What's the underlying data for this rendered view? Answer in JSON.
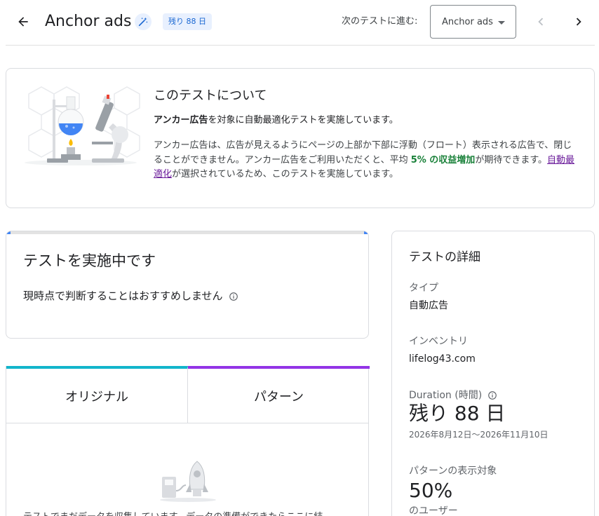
{
  "header": {
    "title": "Anchor ads",
    "days_chip": "残り 88 日",
    "next_label": "次のテストに進む:",
    "next_select_value": "Anchor ads"
  },
  "about": {
    "title": "このテストについて",
    "lead_bold": "アンカー広告",
    "lead_rest": "を対象に自動最適化テストを実施しています。",
    "body_part1": "アンカー広告は、広告が見えるようにページの上部か下部に浮動（フロート）表示される広告で、閉じることができません。アンカー広告をご利用いただくと、平均 ",
    "body_highlight": "5% の収益増加",
    "body_part2": "が期待できます。",
    "body_link": "自動最適化",
    "body_part3": "が選択されているため、このテストを実施しています。"
  },
  "status": {
    "title": "テストを実施中です",
    "note": "現時点で判断することはおすすめしません"
  },
  "compare": {
    "tab_original": "オリジナル",
    "tab_pattern": "パターン",
    "message": "テストでまだデータを収集しています。データの準備ができたらここに結"
  },
  "details": {
    "title": "テストの詳細",
    "type_label": "タイプ",
    "type_value": "自動広告",
    "inventory_label": "インベントリ",
    "inventory_value": "lifelog43.com",
    "duration_label": "Duration (時間)",
    "duration_value": "残り 88 日",
    "duration_range": "2026年8月12日～2026年11月10日",
    "target_label": "パターンの表示対象",
    "target_value": "50%",
    "target_unit": "のユーザー"
  },
  "colors": {
    "accent_blue": "#1967d2",
    "progress_blue": "#4285f4",
    "original_tab": "#12b5cb",
    "pattern_tab": "#9334e6",
    "highlight_green": "#188038",
    "link_purple": "#6a1b9a"
  },
  "icons": [
    "arrow-back-icon",
    "magic-wand-icon",
    "chevron-down-icon",
    "chevron-left-icon",
    "chevron-right-icon",
    "info-icon",
    "lab-illustration",
    "rocket-illustration"
  ]
}
